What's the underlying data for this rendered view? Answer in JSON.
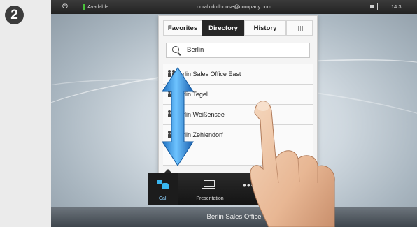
{
  "step": {
    "number": "2"
  },
  "statusbar": {
    "availability": "Available",
    "user_email": "norah.dollhouse@company.com",
    "time": "14:3"
  },
  "tabs": [
    {
      "label": "Favorites",
      "active": false
    },
    {
      "label": "Directory",
      "active": true
    },
    {
      "label": "History",
      "active": false
    },
    {
      "label": "",
      "icon": "grid-icon",
      "active": false
    }
  ],
  "search": {
    "value": "Berlin"
  },
  "results": [
    {
      "label": "rlin Sales Office East",
      "icon": "group-icon"
    },
    {
      "label": "rlin Tegel",
      "icon": "group-icon"
    },
    {
      "label": "rlin Weißensee",
      "icon": "group-icon"
    },
    {
      "label": "rlin Zehlendorf",
      "icon": "group-icon"
    },
    {
      "label": "",
      "icon": ""
    }
  ],
  "tray": {
    "call_label": "Call",
    "presentation_label": "Presentation"
  },
  "bottombar": {
    "title": "Berlin Sales Office"
  },
  "colors": {
    "accent": "#39b6f0",
    "available": "#49c23b",
    "active_tab": "#262626",
    "arrow": "#2d8fdc"
  }
}
